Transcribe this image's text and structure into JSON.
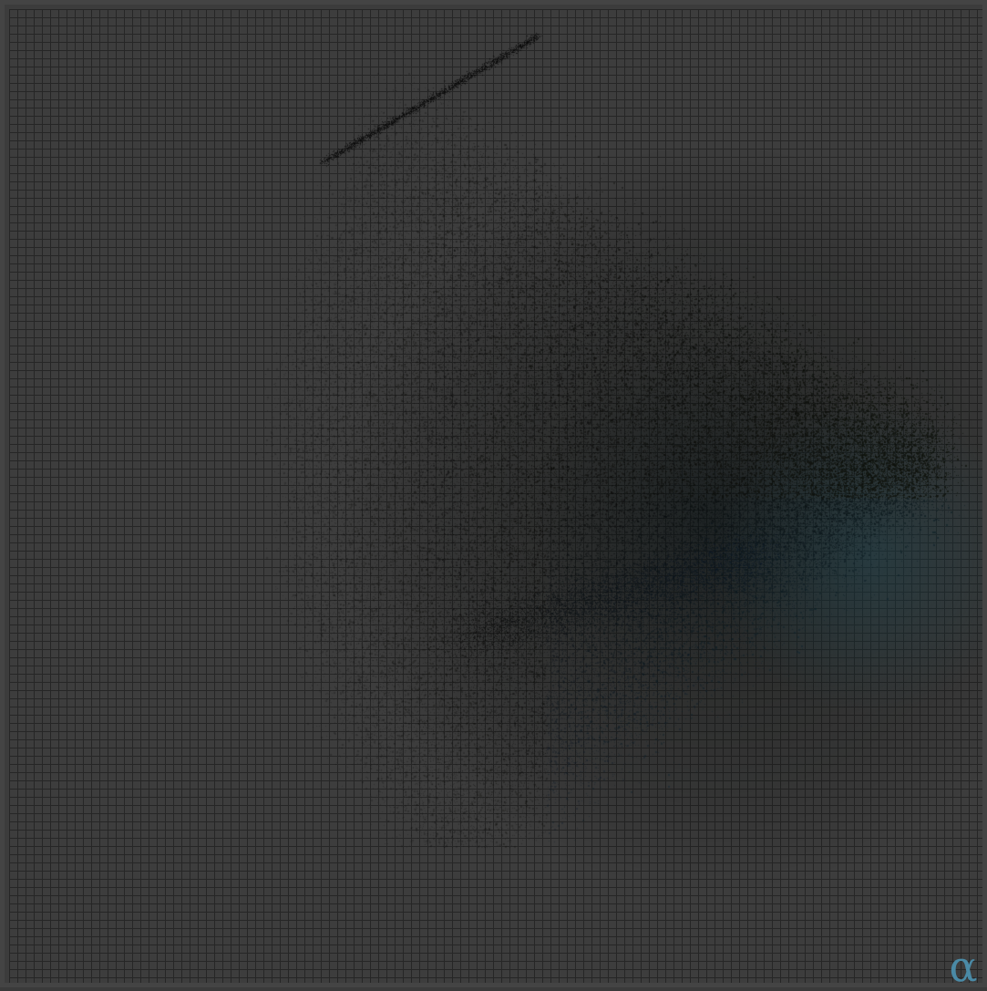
{
  "canvas": {
    "background_color": "#3d3d3d",
    "grid_line_color": "#262626",
    "grid": true,
    "colors": {
      "cloud_dark": "#0a0a08",
      "cloud_olive": "#141a10",
      "cloud_teal": "#1e4a5a",
      "cloud_navy": "#0a1a2a"
    }
  },
  "badge": {
    "icon": "alpha-icon",
    "glyph": "α",
    "color": "#4a8aa6"
  }
}
